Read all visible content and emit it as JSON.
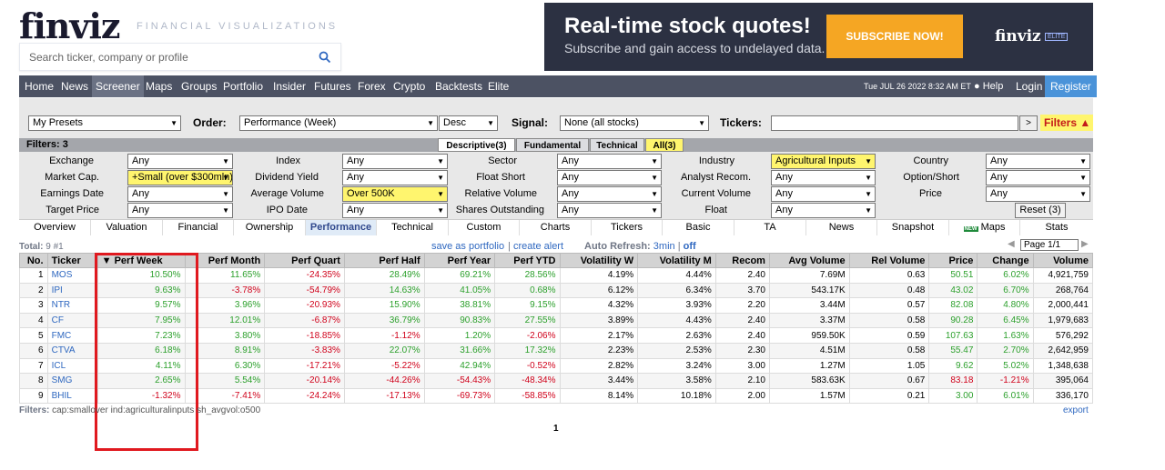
{
  "header": {
    "logo": "finviz",
    "tagline": "FINANCIAL VISUALIZATIONS",
    "search_placeholder": "Search ticker, company or profile",
    "banner_title": "Real-time stock quotes!",
    "banner_sub": "Subscribe and gain access to undelayed data.",
    "banner_button": "SUBSCRIBE NOW!",
    "banner_logo": "finviz",
    "banner_elite": "ELITE"
  },
  "nav": {
    "items": [
      "Home",
      "News",
      "Screener",
      "Maps",
      "Groups",
      "Portfolio",
      "Insider",
      "Futures",
      "Forex",
      "Crypto",
      "Backtests",
      "Elite"
    ],
    "active": "Screener",
    "date": "Tue JUL 26 2022 8:32 AM ET",
    "help": "Help",
    "login": "Login",
    "register": "Register"
  },
  "toolbar": {
    "presets": "My Presets",
    "order_label": "Order:",
    "order_value": "Performance (Week)",
    "direction": "Desc",
    "signal_label": "Signal:",
    "signal_value": "None (all stocks)",
    "tickers_label": "Tickers:",
    "tickers_value": "",
    "go": ">",
    "filters_button": "Filters ▲"
  },
  "filterbar": {
    "label": "Filters: 3",
    "tabs": [
      "Descriptive(3)",
      "Fundamental",
      "Technical",
      "All(3)"
    ]
  },
  "filters": [
    {
      "label": "Exchange",
      "value": "Any"
    },
    {
      "label": "Index",
      "value": "Any"
    },
    {
      "label": "Sector",
      "value": "Any"
    },
    {
      "label": "Industry",
      "value": "Agricultural Inputs"
    },
    {
      "label": "Country",
      "value": "Any"
    },
    {
      "label": "Market Cap.",
      "value": "+Small (over $300mln)"
    },
    {
      "label": "Dividend Yield",
      "value": "Any"
    },
    {
      "label": "Float Short",
      "value": "Any"
    },
    {
      "label": "Analyst Recom.",
      "value": "Any"
    },
    {
      "label": "Option/Short",
      "value": "Any"
    },
    {
      "label": "Earnings Date",
      "value": "Any"
    },
    {
      "label": "Average Volume",
      "value": "Over 500K"
    },
    {
      "label": "Relative Volume",
      "value": "Any"
    },
    {
      "label": "Current Volume",
      "value": "Any"
    },
    {
      "label": "Price",
      "value": "Any"
    },
    {
      "label": "Target Price",
      "value": "Any"
    },
    {
      "label": "IPO Date",
      "value": "Any"
    },
    {
      "label": "Shares Outstanding",
      "value": "Any"
    },
    {
      "label": "Float",
      "value": "Any"
    }
  ],
  "reset_button": "Reset (3)",
  "view_tabs": [
    "Overview",
    "Valuation",
    "Financial",
    "Ownership",
    "Performance",
    "Technical",
    "Custom",
    "Charts",
    "Tickers",
    "Basic",
    "TA",
    "News",
    "Snapshot",
    "Maps",
    "Stats"
  ],
  "view_tabs_active": "Performance",
  "maps_new_badge": "NEW",
  "results": {
    "total_label": "Total:",
    "total_value": "9 #1",
    "save_portfolio": "save as portfolio",
    "separator": "|",
    "create_alert": "create alert",
    "auto_refresh_label": "Auto Refresh:",
    "refresh_interval": "3min",
    "refresh_off": "off",
    "page_select": "Page 1/1"
  },
  "table": {
    "columns": [
      "No.",
      "Ticker",
      "▼ Perf Week",
      "Perf Month",
      "Perf Quart",
      "Perf Half",
      "Perf Year",
      "Perf YTD",
      "Volatility W",
      "Volatility M",
      "Recom",
      "Avg Volume",
      "Rel Volume",
      "Price",
      "Change",
      "Volume"
    ],
    "rows": [
      [
        "1",
        "MOS",
        "10.50%",
        "11.65%",
        "-24.35%",
        "28.49%",
        "69.21%",
        "28.56%",
        "4.19%",
        "4.44%",
        "2.40",
        "7.69M",
        "0.63",
        "50.51",
        "6.02%",
        "4,921,759"
      ],
      [
        "2",
        "IPI",
        "9.63%",
        "-3.78%",
        "-54.79%",
        "14.63%",
        "41.05%",
        "0.68%",
        "6.12%",
        "6.34%",
        "3.70",
        "543.17K",
        "0.48",
        "43.02",
        "6.70%",
        "268,764"
      ],
      [
        "3",
        "NTR",
        "9.57%",
        "3.96%",
        "-20.93%",
        "15.90%",
        "38.81%",
        "9.15%",
        "4.32%",
        "3.93%",
        "2.20",
        "3.44M",
        "0.57",
        "82.08",
        "4.80%",
        "2,000,441"
      ],
      [
        "4",
        "CF",
        "7.95%",
        "12.01%",
        "-6.87%",
        "36.79%",
        "90.83%",
        "27.55%",
        "3.89%",
        "4.43%",
        "2.40",
        "3.37M",
        "0.58",
        "90.28",
        "6.45%",
        "1,979,683"
      ],
      [
        "5",
        "FMC",
        "7.23%",
        "3.80%",
        "-18.85%",
        "-1.12%",
        "1.20%",
        "-2.06%",
        "2.17%",
        "2.63%",
        "2.40",
        "959.50K",
        "0.59",
        "107.63",
        "1.63%",
        "576,292"
      ],
      [
        "6",
        "CTVA",
        "6.18%",
        "8.91%",
        "-3.83%",
        "22.07%",
        "31.66%",
        "17.32%",
        "2.23%",
        "2.53%",
        "2.30",
        "4.51M",
        "0.58",
        "55.47",
        "2.70%",
        "2,642,959"
      ],
      [
        "7",
        "ICL",
        "4.11%",
        "6.30%",
        "-17.21%",
        "-5.22%",
        "42.94%",
        "-0.52%",
        "2.82%",
        "3.24%",
        "3.00",
        "1.27M",
        "1.05",
        "9.62",
        "5.02%",
        "1,348,638"
      ],
      [
        "8",
        "SMG",
        "2.65%",
        "5.54%",
        "-20.14%",
        "-44.26%",
        "-54.43%",
        "-48.34%",
        "3.44%",
        "3.58%",
        "2.10",
        "583.63K",
        "0.67",
        "83.18",
        "-1.21%",
        "395,064"
      ],
      [
        "9",
        "BHIL",
        "-1.32%",
        "-7.41%",
        "-24.24%",
        "-17.13%",
        "-69.73%",
        "-58.85%",
        "8.14%",
        "10.18%",
        "2.00",
        "1.57M",
        "0.21",
        "3.00",
        "6.01%",
        "336,170"
      ]
    ]
  },
  "footer": {
    "filters_label": "Filters:",
    "filters_text": "cap:smallover ind:agriculturalinputs sh_avgvol:o500",
    "export": "export",
    "page": "1"
  },
  "colors": {
    "nav_bg": "#4c5263",
    "positive": "#2ca02c",
    "negative": "#d0021b",
    "link": "#2f68c0",
    "highlight": "#fff56e",
    "annotation_box": "#e0191f"
  }
}
